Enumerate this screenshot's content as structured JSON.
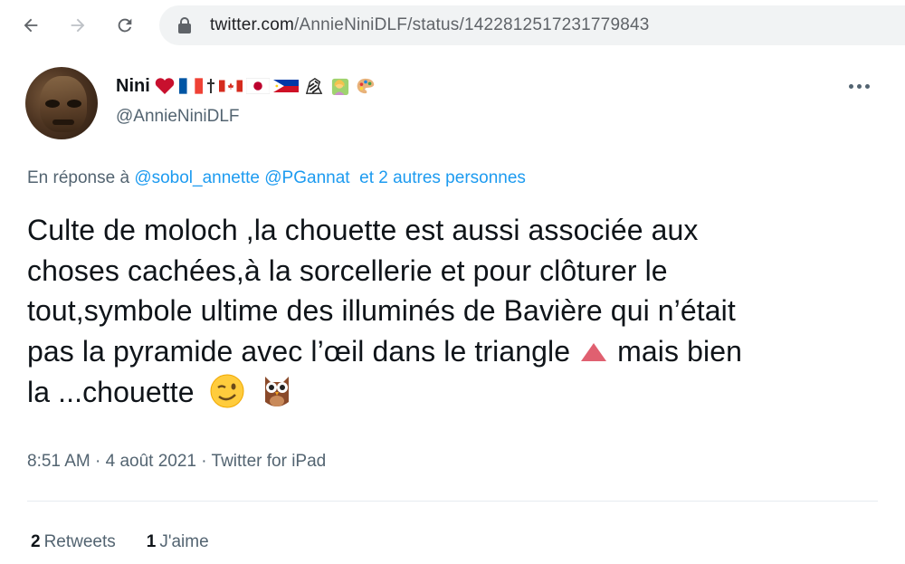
{
  "browser": {
    "url_host": "twitter.com",
    "url_path": "/AnnieNiniDLF/status/1422812517231779843",
    "icons": [
      "back-arrow-icon",
      "forward-arrow-icon",
      "reload-icon",
      "lock-icon"
    ]
  },
  "tweet": {
    "display_name": "Nini",
    "name_emojis": [
      "red-heart",
      "flag-france",
      "latin-cross",
      "flag-canada",
      "flag-japan",
      "flag-philippines",
      "zebra",
      "person-tipping-hand",
      "artist-palette"
    ],
    "handle": "@AnnieNiniDLF",
    "reply_prefix": "En réponse à",
    "reply_mentions": [
      "@sobol_annette",
      "@PGannat"
    ],
    "reply_others": "et 2 autres personnes",
    "text_lines": [
      "Culte de moloch ,la chouette est aussi associée aux",
      "choses cachées,à la sorcellerie et pour clôturer le",
      "tout,symbole ultime des illuminés de Bavière qui n’était",
      "pas la pyramide avec l’œil dans le triangle",
      "mais bien",
      "la ...chouette"
    ],
    "text_emojis": [
      "red-triangle",
      "winking-face",
      "owl"
    ],
    "time": "8:51 AM",
    "date": "4 août 2021",
    "source": "Twitter for iPad",
    "separator": "·",
    "retweets_count": "2",
    "retweets_label": "Retweets",
    "likes_count": "1",
    "likes_label": "J'aime"
  },
  "colors": {
    "text": "#0f1419",
    "secondary": "#536471",
    "link": "#1d9bf0",
    "omnibox_bg": "#f1f3f4"
  }
}
